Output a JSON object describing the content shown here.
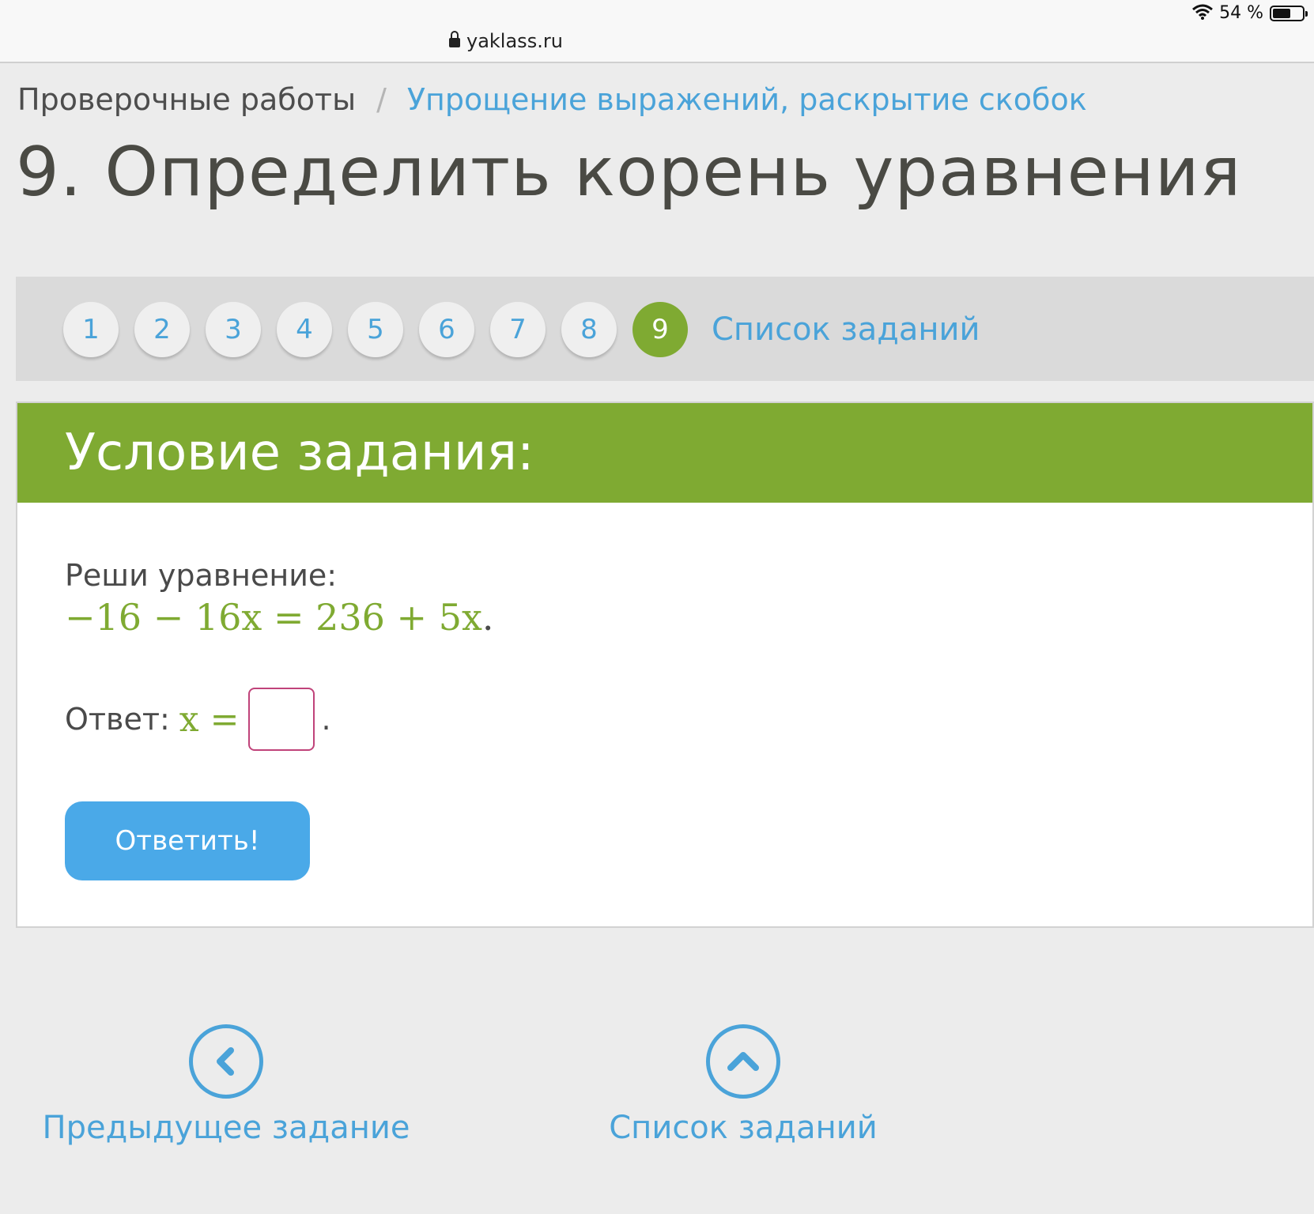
{
  "browser": {
    "url": "yaklass.ru",
    "battery": "54 %"
  },
  "breadcrumb": {
    "root": "Проверочные работы",
    "separator": "/",
    "current": "Упрощение выражений, раскрытие скобок"
  },
  "page_title": "9. Определить корень уравнения",
  "pager": {
    "items": [
      "1",
      "2",
      "3",
      "4",
      "5",
      "6",
      "7",
      "8",
      "9"
    ],
    "active": "9",
    "list_label": "Список заданий"
  },
  "task": {
    "header": "Условие задания:",
    "instruction": "Реши уравнение:",
    "equation": "−16 − 16x = 236 + 5x",
    "equation_end": ".",
    "answer_label": "Ответ:",
    "answer_var": "x =",
    "answer_value": "",
    "answer_end": ".",
    "submit_label": "Ответить!"
  },
  "bottom_nav": {
    "prev_label": "Предыдущее задание",
    "prev_icon": "chevron-left-icon",
    "list_label": "Список заданий",
    "list_icon": "chevron-up-icon"
  },
  "colors": {
    "accent_green": "#7faa32",
    "link_blue": "#4aa3d9",
    "button_blue": "#4aa9e8",
    "input_border": "#c0437a"
  }
}
